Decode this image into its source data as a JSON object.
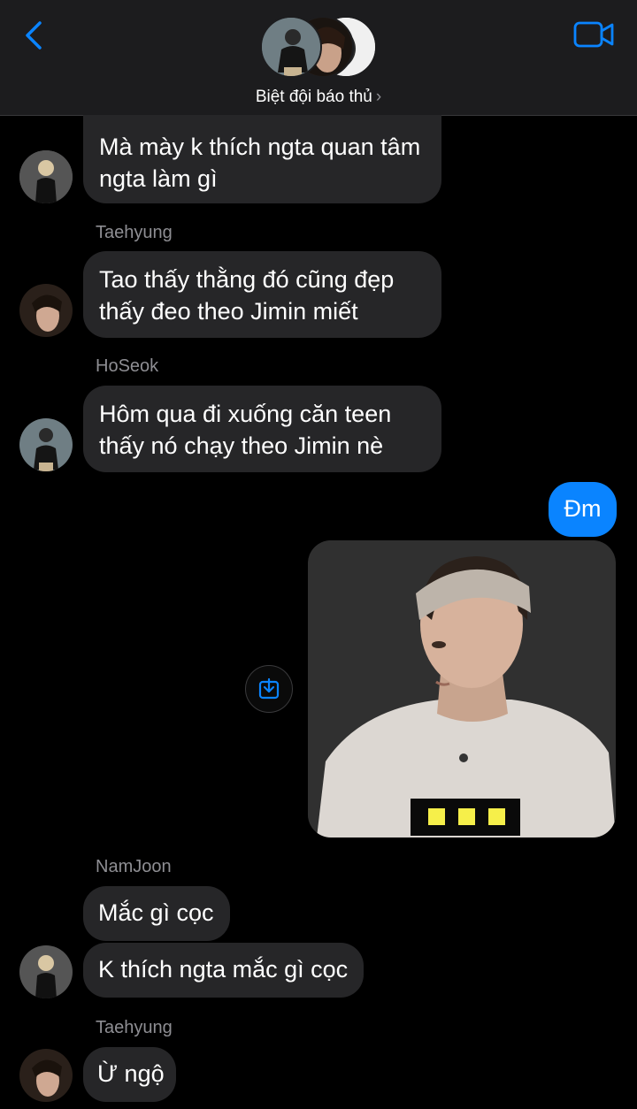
{
  "header": {
    "group_name": "Biệt đội báo thủ",
    "chevron": "›",
    "back_icon": "chevron-left-icon",
    "video_icon": "video-camera-icon"
  },
  "messages": [
    {
      "id": "m1",
      "text": [
        "Mà mày k thích ngta quan tâm",
        "ngta làm gì"
      ]
    },
    {
      "id": "m2",
      "sender": "Taehyung",
      "text": [
        "Tao thấy thằng đó cũng đẹp",
        "thấy đeo theo Jimin miết"
      ]
    },
    {
      "id": "m3",
      "sender": "HoSeok",
      "text": [
        "Hôm qua đi xuống căn teen",
        "thấy nó chạy theo Jimin nè"
      ]
    },
    {
      "id": "m4",
      "outgoing": true,
      "text": [
        "Đm"
      ]
    },
    {
      "id": "m5",
      "outgoing": true,
      "type": "image",
      "description": "photo"
    },
    {
      "id": "m6",
      "sender": "NamJoon",
      "text": [
        "Mắc gì cọc"
      ]
    },
    {
      "id": "m7",
      "text": [
        "K thích ngta mắc gì cọc"
      ]
    },
    {
      "id": "m8",
      "sender": "Taehyung",
      "text": [
        "Ừ ngộ"
      ]
    }
  ],
  "colors": {
    "accent": "#0a84ff",
    "incoming_bubble": "#262628",
    "header_bg": "#1c1c1e",
    "sender_name": "#8e8e93"
  }
}
